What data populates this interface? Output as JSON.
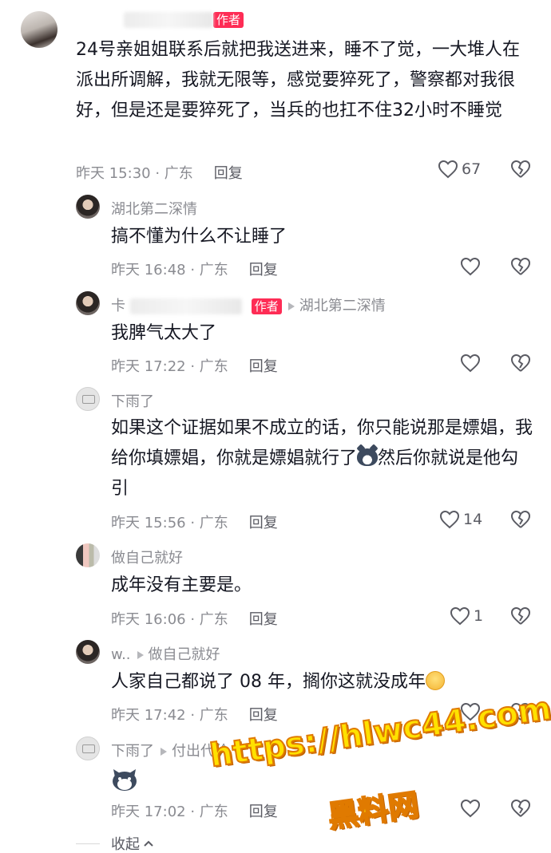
{
  "comments": [
    {
      "user": "",
      "is_author": true,
      "author_label": "作者",
      "text": "24号亲姐姐联系后就把我送进来，睡不了觉，一大堆人在派出所调解，我就无限等，感觉要猝死了，警察都对我很好，但是还是要猝死了，当兵的也扛不住32小时不睡觉",
      "meta": "昨天 15:30 · 广东",
      "reply_label": "回复",
      "likes": "67"
    },
    {
      "user": "湖北第二深情",
      "text": "搞不懂为什么不让睡了",
      "meta": "昨天 16:48 · 广东",
      "reply_label": "回复",
      "likes": ""
    },
    {
      "user": "卡",
      "is_author": true,
      "author_label": "作者",
      "reply_to": "湖北第二深情",
      "text": "我脾气太大了",
      "meta": "昨天 17:22 · 广东",
      "reply_label": "回复",
      "likes": ""
    },
    {
      "user": "下雨了",
      "text": "如果这个证据如果不成立的话，你只能说那是嫖娼，我给你填嫖娼，你就是嫖娼就行了",
      "text_after_emoji": "然后你就说是他勾引",
      "emoji": "bear-icon",
      "meta": "昨天 15:56 · 广东",
      "reply_label": "回复",
      "likes": "14"
    },
    {
      "user": "做自己就好",
      "text": "成年没有主要是。",
      "meta": "昨天 16:06 · 广东",
      "reply_label": "回复",
      "likes": "1"
    },
    {
      "user": "w..",
      "reply_to": "做自己就好",
      "text": "人家自己都说了 08 年，搁你这就没成年",
      "emoji": "smile-icon",
      "meta": "昨天 17:42 · 广东",
      "reply_label": "回复",
      "likes": ""
    },
    {
      "user": "下雨了",
      "reply_to": "付出代价",
      "text": "",
      "emoji": "bear-icon",
      "meta": "昨天 17:02 · 广东",
      "reply_label": "回复",
      "likes": ""
    }
  ],
  "collapse_label": "收起",
  "watermark": {
    "url": "https://hlwc44.com",
    "name": "黑料网"
  },
  "colors": {
    "author_tag": "#fe2c55",
    "secondary_text": "#8a8b91",
    "primary_text": "#161823",
    "watermark_fill": "#ffe100"
  }
}
